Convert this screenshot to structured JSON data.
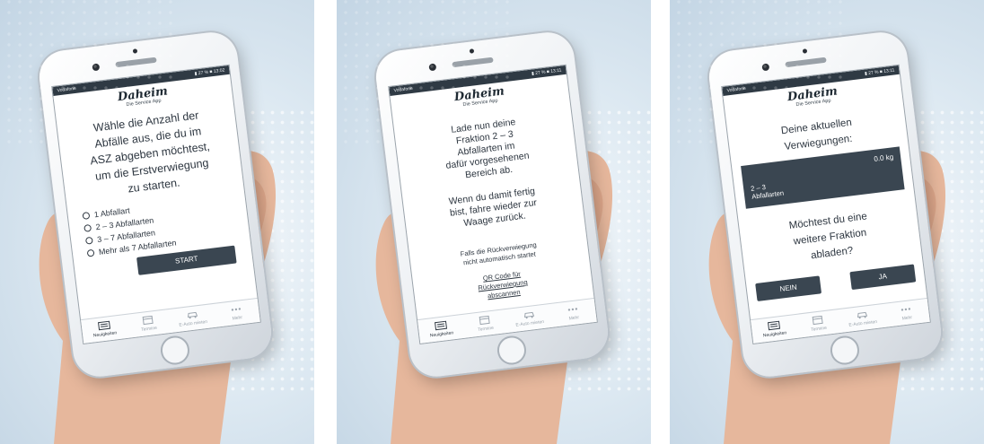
{
  "common": {
    "status_left": "Vodafone",
    "brand_name": "Daheim",
    "brand_sub": "Die Service App",
    "tabs": [
      "Neuigkeiten",
      "Termine",
      "E-Auto mieten",
      "Mehr"
    ]
  },
  "screens": [
    {
      "status_right": "▮ 27 % ■ 13:02",
      "lines": [
        "Wähle die Anzahl der",
        "Abfälle aus, die du im",
        "ASZ abgeben möchtest,",
        "um die Erstverwiegung",
        "zu starten."
      ],
      "options": [
        "1 Abfallart",
        "2 – 3 Abfallarten",
        "3 – 7 Abfallarten",
        "Mehr als 7 Abfallarten"
      ],
      "button": "START"
    },
    {
      "status_right": "▮ 27 % ■ 13:11",
      "lines1": [
        "Lade nun deine",
        "Fraktion 2 – 3",
        "Abfallarten im",
        "dafür vorgesehenen",
        "Bereich ab."
      ],
      "lines2": [
        "Wenn du damit fertig",
        "bist, fahre wieder zur",
        "Waage zurück."
      ],
      "small": [
        "Falls die Rückverwiegung",
        "nicht automatisch startet"
      ],
      "link": [
        "QR Code für",
        "Rückverwiegung",
        "abscannen"
      ]
    },
    {
      "status_right": "▮ 27 % ■ 13:11",
      "lines1": [
        "Deine aktuellen",
        "Verwiegungen:"
      ],
      "weigh_value": "0.0 kg",
      "weigh_label": [
        "2 – 3",
        "Abfallarten"
      ],
      "lines2": [
        "Möchtest du eine",
        "weitere Fraktion",
        "abladen?"
      ],
      "no_button": "NEIN",
      "yes_button": "JA"
    }
  ]
}
